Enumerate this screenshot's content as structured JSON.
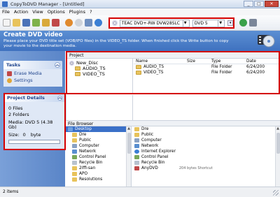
{
  "window": {
    "title": "CopyToDVD Manager - [Untitled]",
    "buttons": [
      "_",
      "□",
      "✕"
    ]
  },
  "menu": [
    "File",
    "Action",
    "View",
    "Options",
    "Plugins",
    "?"
  ],
  "toolbar": {
    "icons": [
      "new-icon",
      "open-icon",
      "save-icon",
      "add-file-icon",
      "add-folder-icon",
      "remove-icon",
      "burn-icon",
      "erase-icon",
      "settings-icon",
      "help-icon",
      "refresh-icon",
      "eject-icon"
    ],
    "drive": "TEAC   DVD+-RW DVW28SLC (D)",
    "media": "DVD 5"
  },
  "header": {
    "title": "Create DVD video",
    "description": "Please place your DVD title set (VOB/IFO files) in the VIDEO_TS folder. When finished click the Write button to copy your movie to the destination media."
  },
  "tasks": {
    "title": "Tasks",
    "items": [
      "Erase Media",
      "Settings"
    ]
  },
  "details": {
    "title": "Project Details",
    "files": "0 Files",
    "folders": "2 Folders",
    "media": "Media: DVD 5 (4.38 Gb)",
    "size_label": "Size:",
    "size_value": "0",
    "size_unit": "byte"
  },
  "project": {
    "title": "Project",
    "tree": [
      "New_Disc",
      "AUDIO_TS",
      "VIDEO_TS"
    ],
    "columns": [
      "Name",
      "Size",
      "Type",
      "Date"
    ],
    "rows": [
      {
        "name": "AUDIO_TS",
        "size": "",
        "type": "File Folder",
        "date": "6/24/200"
      },
      {
        "name": "VIDEO_TS",
        "size": "",
        "type": "File Folder",
        "date": "6/24/200"
      }
    ]
  },
  "filebrowser": {
    "title": "File Browser",
    "tree": [
      "Desktop",
      "Dre",
      "Public",
      "Computer",
      "Network",
      "Control Panel",
      "Recycle Bin",
      "2iffi-san",
      "APO",
      "Resolutions"
    ],
    "list": [
      "Dre",
      "Public",
      "Computer",
      "Network",
      "Internet Explorer",
      "Control Panel",
      "Recycle Bin",
      "AnyDVD"
    ],
    "last_detail": "204 bytes   Shortcut"
  },
  "status": {
    "text": "2 items"
  },
  "colors": {
    "accent": "#3f71bf",
    "highlight_border": "#d40000",
    "folder": "#e8c35c"
  }
}
